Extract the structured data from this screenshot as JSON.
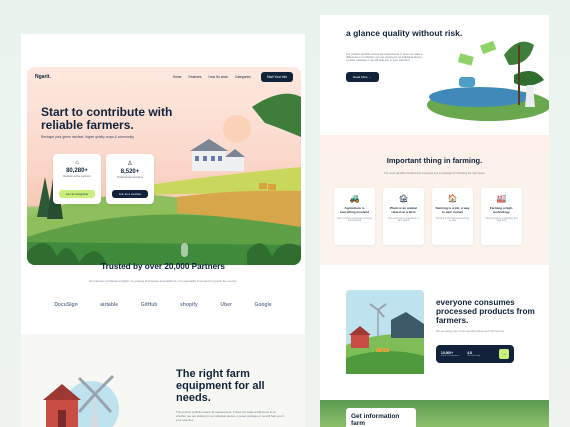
{
  "left": {
    "nav": {
      "logo": "Ngarit.",
      "links": [
        "Home",
        "Features",
        "How it's work",
        "Categories"
      ],
      "cta": "Start Your Info"
    },
    "hero": {
      "title": "Start to contribute with reliable farmers.",
      "subtitle": "Reshape your green mindset, higher quality crops & community.",
      "stats": [
        {
          "icon": "home-icon",
          "value": "80,280+",
          "label": "Register active partners",
          "button": "Join as a beginner"
        },
        {
          "icon": "user-icon",
          "value": "8,520+",
          "label": "Professional members",
          "button": "Join as a member"
        }
      ]
    },
    "trust": {
      "title": "Trusted by over 20,000 Partners",
      "subtitle": "Our partners contribute to Ngarit. As growing businesses and platforms, it is essentially important for growth the country."
    },
    "logos": [
      "DocuSign",
      "airtable",
      "GitHub",
      "shopify",
      "Uber",
      "Google"
    ],
    "feature": {
      "title": "The right farm equipment for all needs.",
      "subtitle": "The product portfolio covers all requirements. It does not make a difference to us whether you are looking for an individual device, a power package or we will help you in your selection."
    }
  },
  "right": {
    "top": {
      "title": "a glance quality without risk.",
      "subtitle": "Our product portfolio covers all requirements. It does not make a difference to us whether you are looking for an individual device, a power package or we will help you in your selection.",
      "button": "Read More →"
    },
    "important": {
      "title": "Important thing in farming.",
      "subtitle": "The most valuable fundamental important and knowledge for following the right steps.",
      "cards": [
        {
          "icon": "tractor-icon",
          "title": "Agriculture is everything involved",
          "desc": "Farm is all the production of crops and livestock"
        },
        {
          "icon": "barn-icon",
          "title": "Plant or an animal raised on a farm",
          "desc": "Fiveyear fruits or animals on a farm raised"
        },
        {
          "icon": "house-icon",
          "title": "Farming is a job, a way to earn money",
          "desc": "Farming is the business and way to earn"
        },
        {
          "icon": "silo-icon",
          "title": "Farming a high-technology",
          "desc": "Farming can be technology and high-tech"
        }
      ]
    },
    "products": {
      "title": "everyone consumes processed products from farmers.",
      "subtitle": "We are taking care of the natural products and with farmers.",
      "stat1_value": "10,000+",
      "stat1_label": "Farm of customers",
      "stat2_value": "4.8",
      "stat2_label": "Overall rating",
      "go": "→"
    },
    "info": {
      "title": "Get information farm"
    }
  },
  "colors": {
    "navy": "#10233a",
    "lime": "#c9ef7a",
    "peach": "#fde8df",
    "green": "#5fa046"
  }
}
